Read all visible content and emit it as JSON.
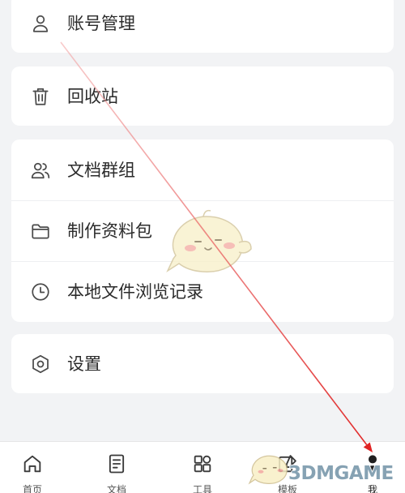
{
  "menu": {
    "groups": [
      {
        "items": [
          {
            "label": "账号管理",
            "icon": "person-icon"
          }
        ]
      },
      {
        "items": [
          {
            "label": "回收站",
            "icon": "trash-icon"
          }
        ]
      },
      {
        "items": [
          {
            "label": "文档群组",
            "icon": "group-icon"
          },
          {
            "label": "制作资料包",
            "icon": "folder-icon"
          },
          {
            "label": "本地文件浏览记录",
            "icon": "clock-icon"
          }
        ]
      },
      {
        "items": [
          {
            "label": "设置",
            "icon": "settings-icon"
          }
        ]
      }
    ]
  },
  "bottom_nav": {
    "tabs": [
      {
        "label": "首页",
        "icon": "home-icon",
        "active": false
      },
      {
        "label": "文档",
        "icon": "document-icon",
        "active": false
      },
      {
        "label": "工具",
        "icon": "tools-grid-icon",
        "active": false
      },
      {
        "label": "模板",
        "icon": "template-icon",
        "active": false
      },
      {
        "label": "我",
        "icon": "profile-icon",
        "active": true
      }
    ]
  },
  "annotation": {
    "color": "#e02424"
  },
  "watermark": {
    "text": "3DMGAME",
    "mascot_icon": "chick-mascot-icon"
  },
  "colors": {
    "background": "#f2f3f5",
    "card": "#ffffff",
    "text": "#2b2b2b",
    "icon": "#4a4a4a",
    "active_tab": "#1f1f1f",
    "inactive_tab": "#555555"
  }
}
